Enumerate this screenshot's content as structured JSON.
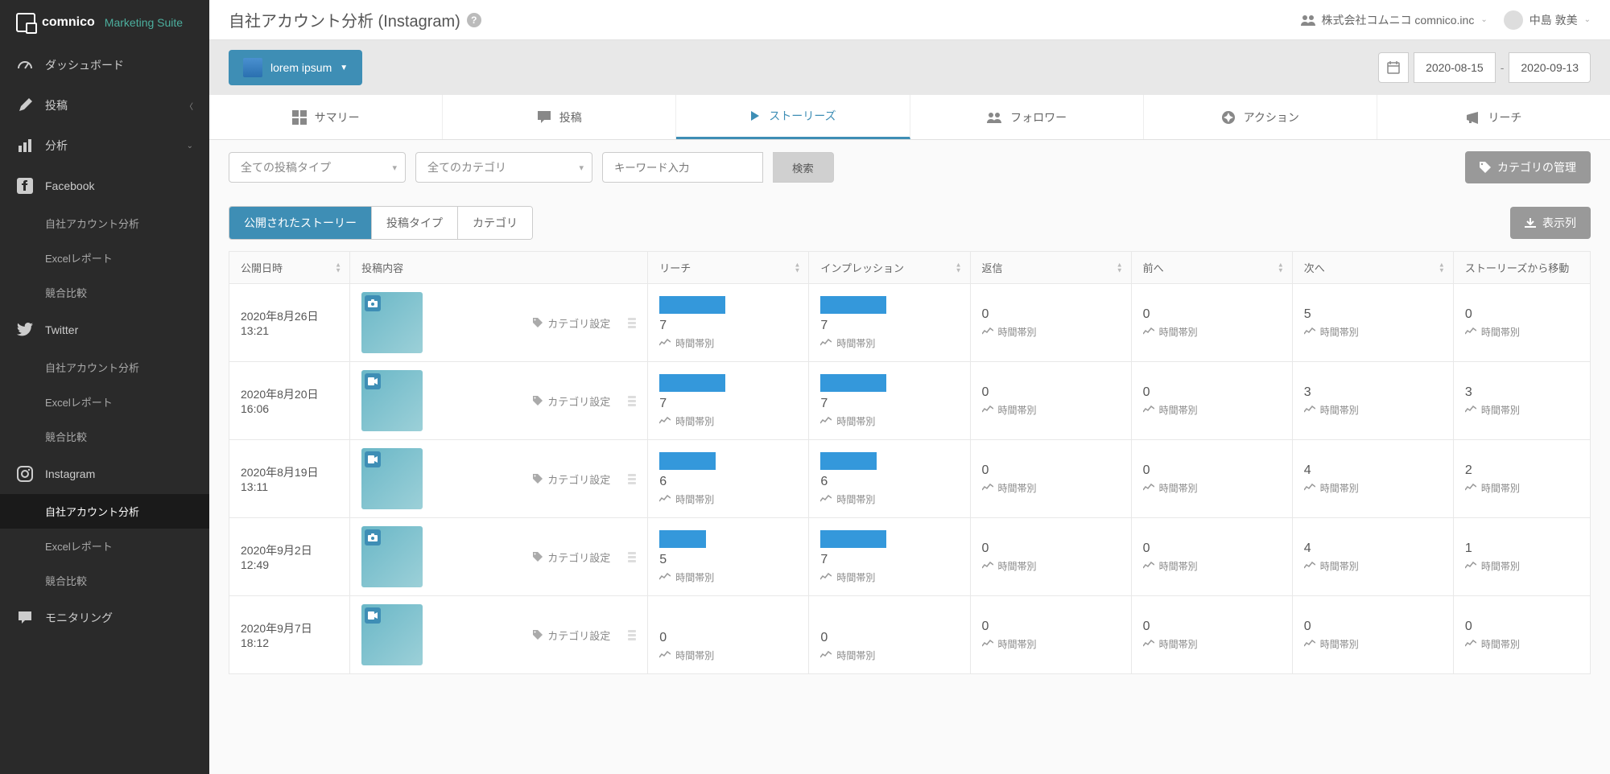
{
  "brand": {
    "name": "comnico",
    "sub": "Marketing Suite"
  },
  "page_title": "自社アカウント分析 (Instagram)",
  "org": {
    "label": "株式会社コムニコ comnico.inc"
  },
  "user": {
    "label": "中島 敦美"
  },
  "sidebar": {
    "dashboard": "ダッシュボード",
    "post": "投稿",
    "analysis": "分析",
    "facebook": "Facebook",
    "twitter": "Twitter",
    "instagram": "Instagram",
    "own_account": "自社アカウント分析",
    "excel": "Excelレポート",
    "compare": "競合比較",
    "monitoring": "モニタリング"
  },
  "account_dropdown": "lorem ipsum",
  "date": {
    "start": "2020-08-15",
    "sep": "-",
    "end": "2020-09-13"
  },
  "tabs": {
    "summary": "サマリー",
    "posts": "投稿",
    "stories": "ストーリーズ",
    "followers": "フォロワー",
    "actions": "アクション",
    "reach": "リーチ"
  },
  "filters": {
    "post_type": "全ての投稿タイプ",
    "category": "全てのカテゴリ",
    "search_placeholder": "キーワード入力",
    "search_btn": "検索",
    "manage_cat": "カテゴリの管理"
  },
  "chips": {
    "published": "公開されたストーリー",
    "post_type": "投稿タイプ",
    "category": "カテゴリ"
  },
  "cols_btn": "表示列",
  "headers": {
    "date": "公開日時",
    "content": "投稿内容",
    "reach": "リーチ",
    "impressions": "インプレッション",
    "replies": "返信",
    "back": "前へ",
    "next": "次へ",
    "exits": "ストーリーズから移動"
  },
  "time_label": "時間帯別",
  "cat_set_label": "カテゴリ設定",
  "rows": [
    {
      "date": "2020年8月26日 13:21",
      "type": "photo",
      "reach": 7,
      "reach_w": 82,
      "imp": 7,
      "imp_w": 82,
      "replies": 0,
      "back": 0,
      "next": 5,
      "exits": 0
    },
    {
      "date": "2020年8月20日 16:06",
      "type": "video",
      "reach": 7,
      "reach_w": 82,
      "imp": 7,
      "imp_w": 82,
      "replies": 0,
      "back": 0,
      "next": 3,
      "exits": 3
    },
    {
      "date": "2020年8月19日 13:11",
      "type": "video",
      "reach": 6,
      "reach_w": 70,
      "imp": 6,
      "imp_w": 70,
      "replies": 0,
      "back": 0,
      "next": 4,
      "exits": 2
    },
    {
      "date": "2020年9月2日 12:49",
      "type": "photo",
      "reach": 5,
      "reach_w": 58,
      "imp": 7,
      "imp_w": 82,
      "replies": 0,
      "back": 0,
      "next": 4,
      "exits": 1
    },
    {
      "date": "2020年9月7日 18:12",
      "type": "video",
      "reach": 0,
      "reach_w": 0,
      "imp": 0,
      "imp_w": 0,
      "replies": 0,
      "back": 0,
      "next": 0,
      "exits": 0
    }
  ]
}
